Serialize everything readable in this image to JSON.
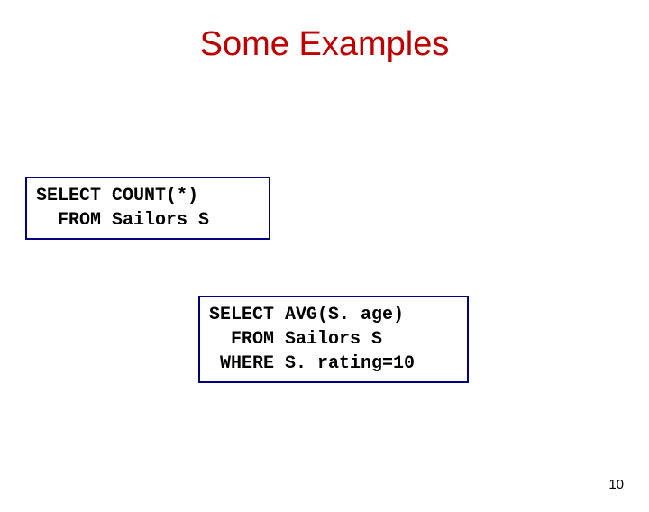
{
  "title": "Some Examples",
  "box1": {
    "line1": "SELECT COUNT(*)",
    "line2": "  FROM Sailors S"
  },
  "box2": {
    "line1": "SELECT AVG(S. age)",
    "line2": "  FROM Sailors S",
    "line3": " WHERE S. rating=10"
  },
  "page_number": "10"
}
